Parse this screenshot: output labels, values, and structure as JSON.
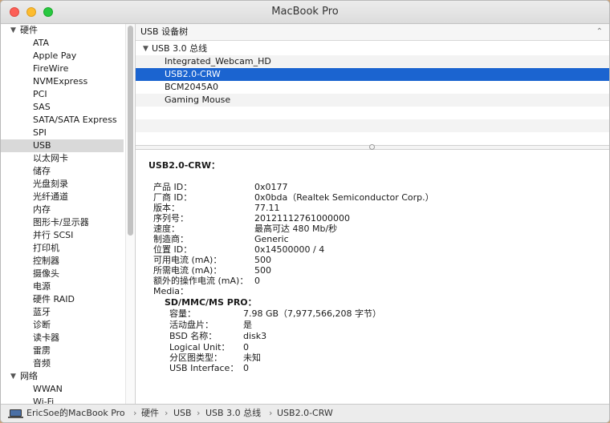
{
  "window": {
    "title": "MacBook Pro"
  },
  "sidebar": {
    "groups": [
      {
        "label": "硬件",
        "expanded": true,
        "items": [
          "ATA",
          "Apple Pay",
          "FireWire",
          "NVMExpress",
          "PCI",
          "SAS",
          "SATA/SATA Express",
          "SPI",
          "USB",
          "以太网卡",
          "储存",
          "光盘刻录",
          "光纤通道",
          "内存",
          "图形卡/显示器",
          "并行 SCSI",
          "打印机",
          "控制器",
          "摄像头",
          "电源",
          "硬件 RAID",
          "蓝牙",
          "诊断",
          "读卡器",
          "雷雳",
          "音频"
        ],
        "selected": "USB"
      },
      {
        "label": "网络",
        "expanded": true,
        "items": [
          "WWAN",
          "Wi-Fi"
        ]
      }
    ]
  },
  "main": {
    "header": "USB 设备树",
    "tree": {
      "root": "USB 3.0 总线",
      "children": [
        "Integrated_Webcam_HD",
        "USB2.0-CRW",
        "BCM2045A0",
        "Gaming Mouse"
      ],
      "selected": "USB2.0-CRW"
    },
    "detail": {
      "title": "USB2.0-CRW：",
      "fields": [
        {
          "k": "产品 ID：",
          "v": "0x0177"
        },
        {
          "k": "厂商 ID：",
          "v": "0x0bda（Realtek Semiconductor Corp.）"
        },
        {
          "k": "版本：",
          "v": "77.11"
        },
        {
          "k": "序列号：",
          "v": "20121112761000000"
        },
        {
          "k": "速度：",
          "v": "最高可达 480 Mb/秒"
        },
        {
          "k": "制造商：",
          "v": "Generic"
        },
        {
          "k": "位置 ID：",
          "v": "0x14500000 / 4"
        },
        {
          "k": "可用电流 (mA)：",
          "v": "500"
        },
        {
          "k": "所需电流 (mA)：",
          "v": "500"
        },
        {
          "k": "额外的操作电流 (mA)：",
          "v": "0"
        },
        {
          "k": "Media：",
          "v": ""
        }
      ],
      "media_title": "SD/MMC/MS PRO：",
      "media_fields": [
        {
          "k": "容量：",
          "v": "7.98 GB（7,977,566,208 字节）"
        },
        {
          "k": "活动盘片：",
          "v": "是"
        },
        {
          "k": "BSD 名称：",
          "v": "disk3"
        },
        {
          "k": "Logical Unit：",
          "v": "0"
        },
        {
          "k": "分区图类型：",
          "v": "未知"
        },
        {
          "k": "USB Interface：",
          "v": "0"
        }
      ]
    }
  },
  "status_bar": {
    "path": [
      "EricSoe的MacBook Pro",
      "硬件",
      "USB",
      "USB 3.0 总线",
      "USB2.0-CRW"
    ],
    "separator": "›"
  }
}
